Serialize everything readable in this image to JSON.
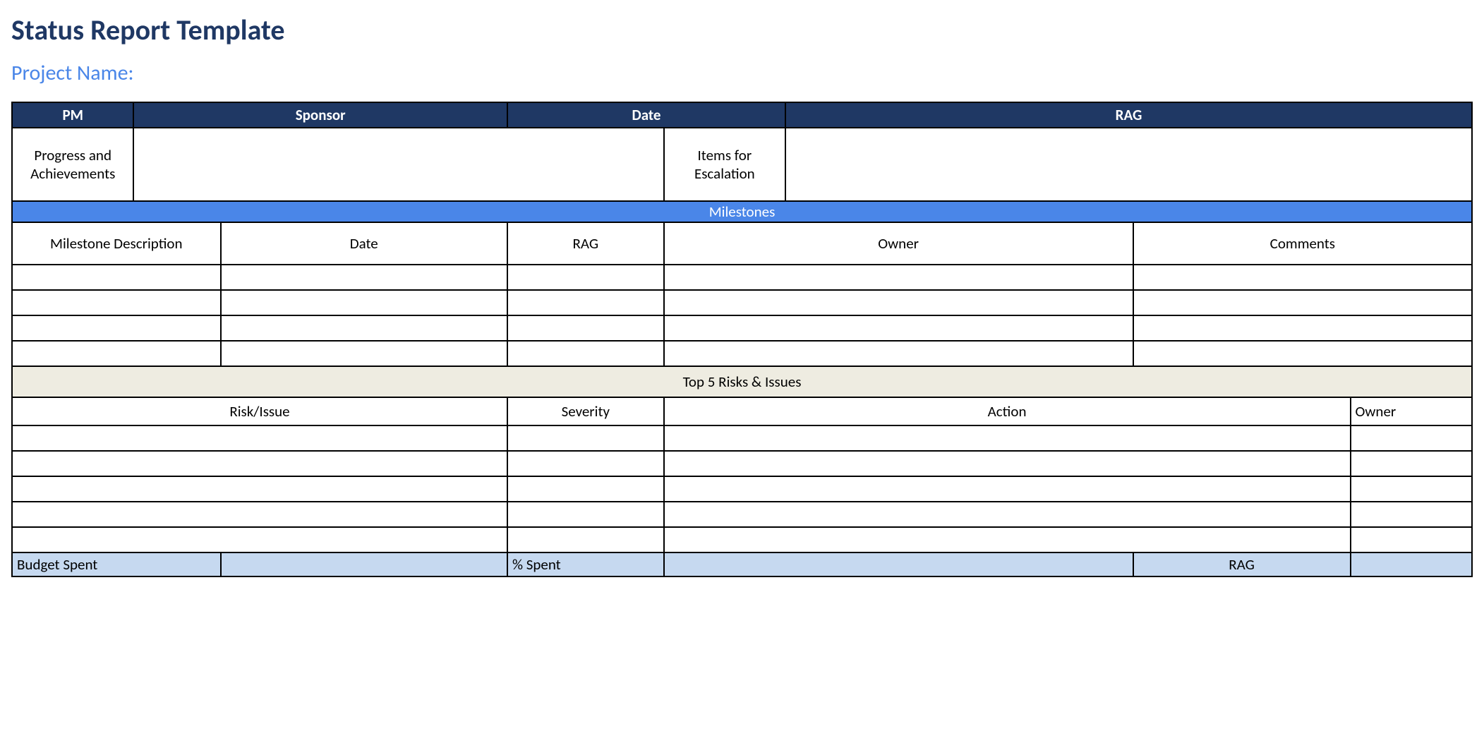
{
  "title": "Status Report Template",
  "subtitle": "Project Name:",
  "header": {
    "pm": "PM",
    "sponsor": "Sponsor",
    "date": "Date",
    "rag": "RAG"
  },
  "labels": {
    "progress": "Progress and Achievements",
    "escalation": "Items for Escalation"
  },
  "milestones": {
    "bar": "Milestones",
    "cols": {
      "desc": "Milestone Description",
      "date": "Date",
      "rag": "RAG",
      "owner": "Owner",
      "comments": "Comments"
    }
  },
  "risks": {
    "bar": "Top 5 Risks & Issues",
    "cols": {
      "risk": "Risk/Issue",
      "severity": "Severity",
      "action": "Action",
      "owner": "Owner"
    }
  },
  "budget": {
    "spent": "Budget Spent",
    "pct": "% Spent",
    "rag": "RAG"
  }
}
